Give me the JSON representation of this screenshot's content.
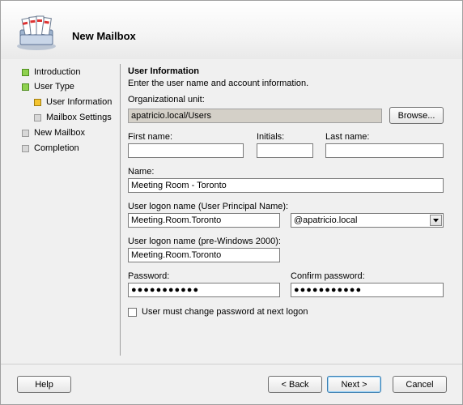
{
  "wizard": {
    "title": "New Mailbox"
  },
  "nav": {
    "items": [
      {
        "label": "Introduction",
        "state": "done"
      },
      {
        "label": "User Type",
        "state": "done"
      },
      {
        "label": "User Information",
        "state": "current"
      },
      {
        "label": "Mailbox Settings",
        "state": "pending"
      },
      {
        "label": "New Mailbox",
        "state": "pending"
      },
      {
        "label": "Completion",
        "state": "pending"
      }
    ]
  },
  "section": {
    "title": "User Information",
    "description": "Enter the user name and account information."
  },
  "form": {
    "org_unit_label": "Organizational unit:",
    "org_unit_value": "apatricio.local/Users",
    "browse_label": "Browse...",
    "first_name_label": "First name:",
    "first_name_value": "",
    "initials_label": "Initials:",
    "initials_value": "",
    "last_name_label": "Last name:",
    "last_name_value": "",
    "name_label": "Name:",
    "name_value": "Meeting Room - Toronto",
    "upn_label": "User logon name (User Principal Name):",
    "upn_value": "Meeting.Room.Toronto",
    "domain_value": "@apatricio.local",
    "pre2000_label": "User logon name (pre-Windows 2000):",
    "pre2000_value": "Meeting.Room.Toronto",
    "password_label": "Password:",
    "password_value": "●●●●●●●●●●●",
    "confirm_label": "Confirm password:",
    "confirm_value": "●●●●●●●●●●●",
    "must_change_label": "User must change password at next logon",
    "must_change_checked": false
  },
  "buttons": {
    "help": "Help",
    "back": "< Back",
    "next": "Next >",
    "cancel": "Cancel"
  },
  "colors": {
    "done": "#8fd14f",
    "current": "#f4c430",
    "pending": "#d8d8d8"
  }
}
